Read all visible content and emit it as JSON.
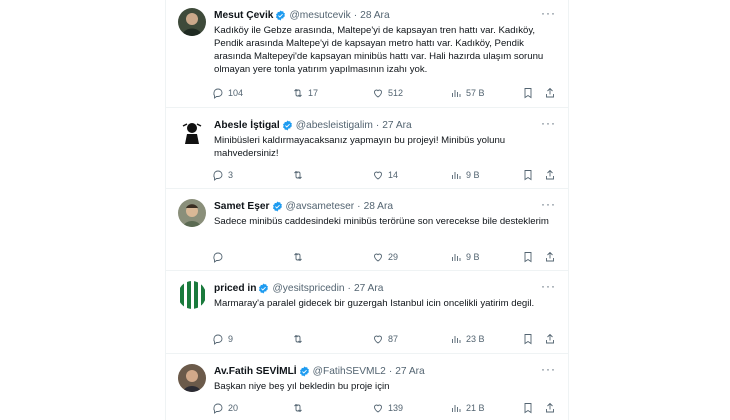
{
  "tweets": [
    {
      "name": "Mesut Çevik",
      "handle": "@mesutcevik",
      "date": "28 Ara",
      "text": "Kadıköy ile Gebze arasında, Maltepe'yi de kapsayan tren hattı var. Kadıköy, Pendik arasında Maltepe'yi de kapsayan metro hattı var. Kadıköy, Pendik arasında Maltepeyi'de kapsayan minibüs hattı var. Hali hazırda ulaşım sorunu olmayan yere tonla yatırım yapılmasının izahı yok.",
      "replies": "104",
      "retweets": "17",
      "likes": "512",
      "views": "57 B"
    },
    {
      "name": "Abesle İştigal",
      "handle": "@abesleistigalim",
      "date": "27 Ara",
      "text": "Minibüsleri kaldırmayacaksanız yapmayın bu projeyi! Minibüs yolunu mahvedersiniz!",
      "replies": "",
      "retweets": "",
      "likes": "14",
      "views": "9 B"
    },
    {
      "name": "Samet Eşer",
      "handle": "@avsameteser",
      "date": "28 Ara",
      "text": "Sadece minibüs caddesindeki minibüs terörüne son verecekse bile desteklerim",
      "replies": "",
      "retweets": "",
      "likes": "29",
      "views": "9 B"
    },
    {
      "name": "priced in",
      "handle": "@yesitspricedin",
      "date": "27 Ara",
      "text": "Marmaray'a paralel gidecek bir guzergah Istanbul icin oncelikli yatirim degil.",
      "replies": "9",
      "retweets": "",
      "likes": "87",
      "views": "23 B"
    },
    {
      "name": "Av.Fatih SEVİMLİ",
      "handle": "@FatihSEVML2",
      "date": "27 Ara",
      "text": "Başkan niye beş yıl bekledin bu proje için",
      "replies": "20",
      "retweets": "",
      "likes": "139",
      "views": "21 B"
    }
  ],
  "tweet2_replies": "3",
  "colors": {
    "verified": "#1d9bf0",
    "icon": "#536471",
    "text": "#0f1419",
    "border": "#eff3f4"
  },
  "icons": [
    "reply-icon",
    "retweet-icon",
    "like-icon",
    "views-icon",
    "bookmark-icon",
    "share-icon",
    "verified-badge-icon",
    "more-icon"
  ]
}
